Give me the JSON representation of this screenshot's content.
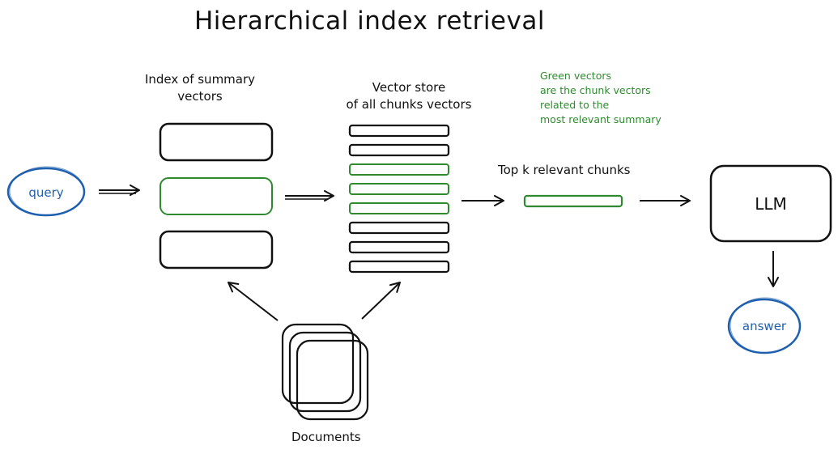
{
  "title": "Hierarchical index retrieval",
  "nodes": {
    "query": {
      "label": "query",
      "shape": "ellipse",
      "color": "#1e5fae"
    },
    "summary_index": {
      "label_line1": "Index of summary",
      "label_line2": "vectors",
      "boxes": [
        {
          "highlighted": false
        },
        {
          "highlighted": true
        },
        {
          "highlighted": false
        }
      ]
    },
    "vector_store": {
      "label_line1": "Vector store",
      "label_line2": "of all chunks vectors",
      "chunks": [
        {
          "highlighted": false
        },
        {
          "highlighted": false
        },
        {
          "highlighted": true
        },
        {
          "highlighted": true
        },
        {
          "highlighted": true
        },
        {
          "highlighted": false
        },
        {
          "highlighted": false
        },
        {
          "highlighted": false
        }
      ]
    },
    "top_k": {
      "label": "Top k relevant chunks",
      "highlighted": true
    },
    "llm": {
      "label": "LLM"
    },
    "answer": {
      "label": "answer",
      "shape": "ellipse",
      "color": "#1e5fae"
    },
    "documents": {
      "label": "Documents",
      "icon": "stacked-documents-icon"
    }
  },
  "note": {
    "lines": [
      "Green vectors",
      "are the chunk vectors",
      "related to the",
      "most relevant summary"
    ],
    "color": "#2f8a2f"
  },
  "edges": [
    {
      "from": "query",
      "to": "summary_index"
    },
    {
      "from": "summary_index",
      "to": "vector_store"
    },
    {
      "from": "vector_store",
      "to": "top_k"
    },
    {
      "from": "top_k",
      "to": "llm"
    },
    {
      "from": "llm",
      "to": "answer"
    },
    {
      "from": "documents",
      "to": "summary_index"
    },
    {
      "from": "documents",
      "to": "vector_store"
    }
  ],
  "colors": {
    "stroke": "#111111",
    "highlight": "#2f8a2f",
    "ellipse": "#1e5fae"
  }
}
